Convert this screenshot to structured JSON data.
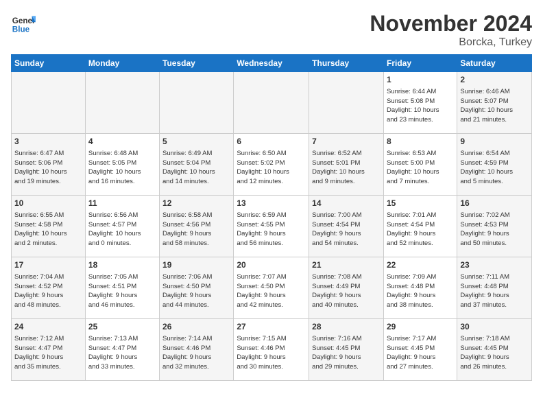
{
  "logo": {
    "line1": "General",
    "line2": "Blue"
  },
  "header": {
    "month": "November 2024",
    "location": "Borcka, Turkey"
  },
  "weekdays": [
    "Sunday",
    "Monday",
    "Tuesday",
    "Wednesday",
    "Thursday",
    "Friday",
    "Saturday"
  ],
  "weeks": [
    [
      {
        "day": "",
        "info": ""
      },
      {
        "day": "",
        "info": ""
      },
      {
        "day": "",
        "info": ""
      },
      {
        "day": "",
        "info": ""
      },
      {
        "day": "",
        "info": ""
      },
      {
        "day": "1",
        "info": "Sunrise: 6:44 AM\nSunset: 5:08 PM\nDaylight: 10 hours\nand 23 minutes."
      },
      {
        "day": "2",
        "info": "Sunrise: 6:46 AM\nSunset: 5:07 PM\nDaylight: 10 hours\nand 21 minutes."
      }
    ],
    [
      {
        "day": "3",
        "info": "Sunrise: 6:47 AM\nSunset: 5:06 PM\nDaylight: 10 hours\nand 19 minutes."
      },
      {
        "day": "4",
        "info": "Sunrise: 6:48 AM\nSunset: 5:05 PM\nDaylight: 10 hours\nand 16 minutes."
      },
      {
        "day": "5",
        "info": "Sunrise: 6:49 AM\nSunset: 5:04 PM\nDaylight: 10 hours\nand 14 minutes."
      },
      {
        "day": "6",
        "info": "Sunrise: 6:50 AM\nSunset: 5:02 PM\nDaylight: 10 hours\nand 12 minutes."
      },
      {
        "day": "7",
        "info": "Sunrise: 6:52 AM\nSunset: 5:01 PM\nDaylight: 10 hours\nand 9 minutes."
      },
      {
        "day": "8",
        "info": "Sunrise: 6:53 AM\nSunset: 5:00 PM\nDaylight: 10 hours\nand 7 minutes."
      },
      {
        "day": "9",
        "info": "Sunrise: 6:54 AM\nSunset: 4:59 PM\nDaylight: 10 hours\nand 5 minutes."
      }
    ],
    [
      {
        "day": "10",
        "info": "Sunrise: 6:55 AM\nSunset: 4:58 PM\nDaylight: 10 hours\nand 2 minutes."
      },
      {
        "day": "11",
        "info": "Sunrise: 6:56 AM\nSunset: 4:57 PM\nDaylight: 10 hours\nand 0 minutes."
      },
      {
        "day": "12",
        "info": "Sunrise: 6:58 AM\nSunset: 4:56 PM\nDaylight: 9 hours\nand 58 minutes."
      },
      {
        "day": "13",
        "info": "Sunrise: 6:59 AM\nSunset: 4:55 PM\nDaylight: 9 hours\nand 56 minutes."
      },
      {
        "day": "14",
        "info": "Sunrise: 7:00 AM\nSunset: 4:54 PM\nDaylight: 9 hours\nand 54 minutes."
      },
      {
        "day": "15",
        "info": "Sunrise: 7:01 AM\nSunset: 4:54 PM\nDaylight: 9 hours\nand 52 minutes."
      },
      {
        "day": "16",
        "info": "Sunrise: 7:02 AM\nSunset: 4:53 PM\nDaylight: 9 hours\nand 50 minutes."
      }
    ],
    [
      {
        "day": "17",
        "info": "Sunrise: 7:04 AM\nSunset: 4:52 PM\nDaylight: 9 hours\nand 48 minutes."
      },
      {
        "day": "18",
        "info": "Sunrise: 7:05 AM\nSunset: 4:51 PM\nDaylight: 9 hours\nand 46 minutes."
      },
      {
        "day": "19",
        "info": "Sunrise: 7:06 AM\nSunset: 4:50 PM\nDaylight: 9 hours\nand 44 minutes."
      },
      {
        "day": "20",
        "info": "Sunrise: 7:07 AM\nSunset: 4:50 PM\nDaylight: 9 hours\nand 42 minutes."
      },
      {
        "day": "21",
        "info": "Sunrise: 7:08 AM\nSunset: 4:49 PM\nDaylight: 9 hours\nand 40 minutes."
      },
      {
        "day": "22",
        "info": "Sunrise: 7:09 AM\nSunset: 4:48 PM\nDaylight: 9 hours\nand 38 minutes."
      },
      {
        "day": "23",
        "info": "Sunrise: 7:11 AM\nSunset: 4:48 PM\nDaylight: 9 hours\nand 37 minutes."
      }
    ],
    [
      {
        "day": "24",
        "info": "Sunrise: 7:12 AM\nSunset: 4:47 PM\nDaylight: 9 hours\nand 35 minutes."
      },
      {
        "day": "25",
        "info": "Sunrise: 7:13 AM\nSunset: 4:47 PM\nDaylight: 9 hours\nand 33 minutes."
      },
      {
        "day": "26",
        "info": "Sunrise: 7:14 AM\nSunset: 4:46 PM\nDaylight: 9 hours\nand 32 minutes."
      },
      {
        "day": "27",
        "info": "Sunrise: 7:15 AM\nSunset: 4:46 PM\nDaylight: 9 hours\nand 30 minutes."
      },
      {
        "day": "28",
        "info": "Sunrise: 7:16 AM\nSunset: 4:45 PM\nDaylight: 9 hours\nand 29 minutes."
      },
      {
        "day": "29",
        "info": "Sunrise: 7:17 AM\nSunset: 4:45 PM\nDaylight: 9 hours\nand 27 minutes."
      },
      {
        "day": "30",
        "info": "Sunrise: 7:18 AM\nSunset: 4:45 PM\nDaylight: 9 hours\nand 26 minutes."
      }
    ]
  ]
}
